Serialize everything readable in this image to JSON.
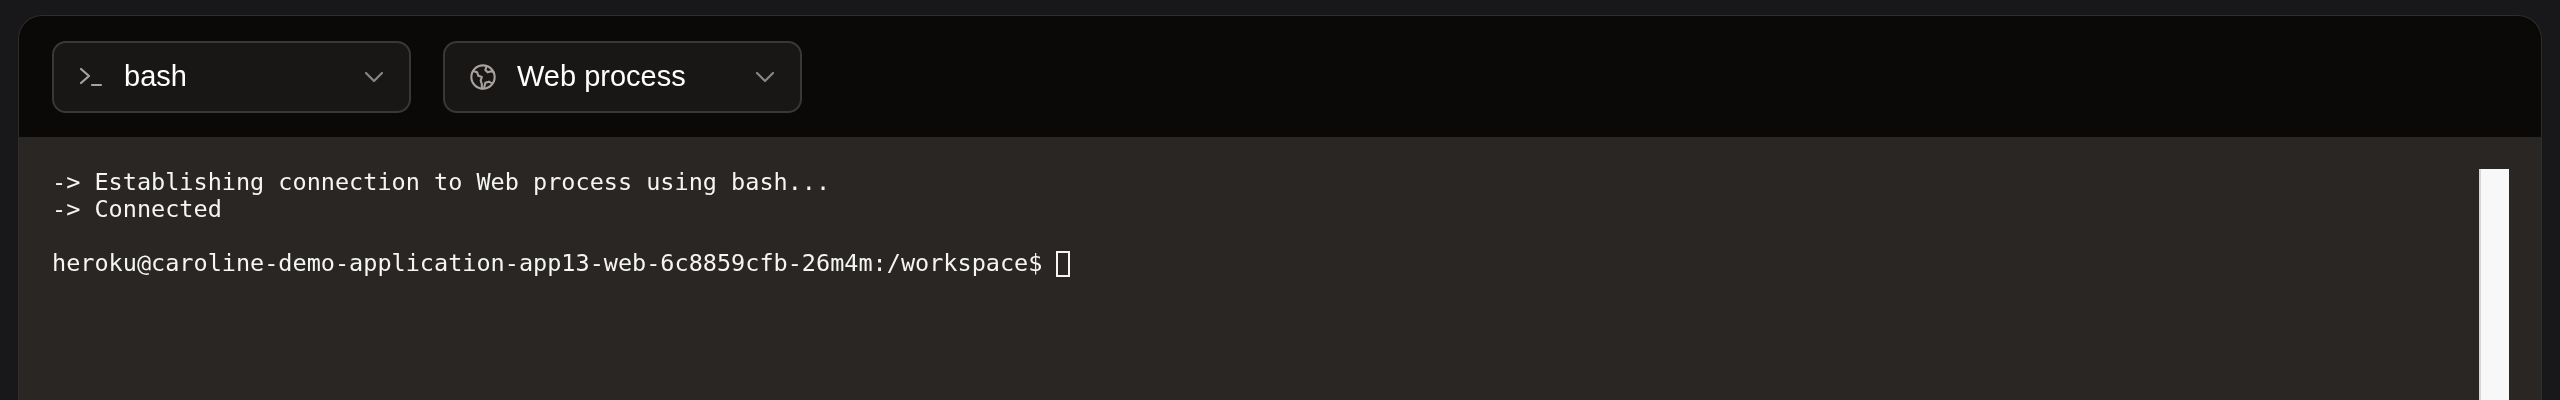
{
  "selectors": [
    {
      "kind": "shell",
      "label": "bash"
    },
    {
      "kind": "process",
      "label": "Web process"
    }
  ],
  "terminal": {
    "lines": [
      "-> Establishing connection to Web process using bash...",
      "-> Connected"
    ],
    "prompt": "heroku@caroline-demo-application-app13-web-6c8859cfb-26m4m:/workspace$"
  }
}
